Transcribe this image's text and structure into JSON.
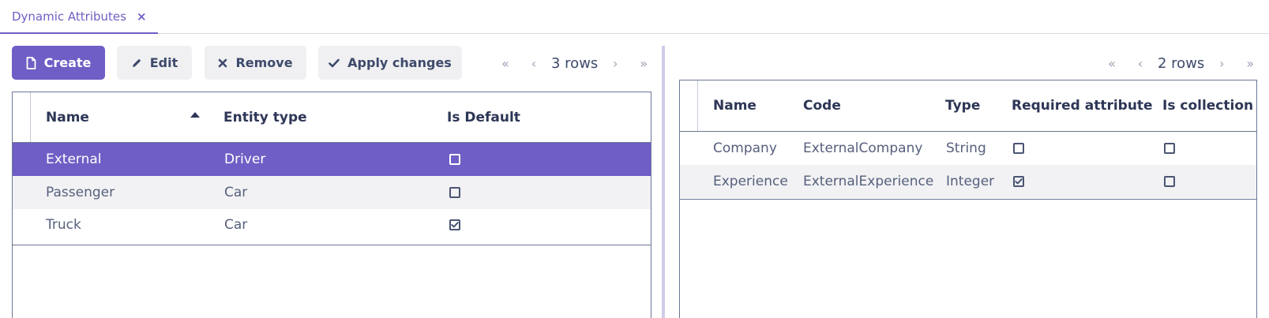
{
  "tab": {
    "label": "Dynamic Attributes",
    "close": "×"
  },
  "toolbar": {
    "create": "Create",
    "edit": "Edit",
    "remove": "Remove",
    "apply": "Apply changes"
  },
  "left_pager": {
    "first": "«",
    "prev": "‹",
    "rows": "3 rows",
    "next": "›",
    "last": "»"
  },
  "right_pager": {
    "first": "«",
    "prev": "‹",
    "rows": "2 rows",
    "next": "›",
    "last": "»"
  },
  "categories": {
    "headers": {
      "name": "Name",
      "entity_type": "Entity type",
      "is_default": "Is Default"
    },
    "sort": {
      "column": "name",
      "direction": "ascending"
    },
    "rows": [
      {
        "name": "External",
        "entity_type": "Driver",
        "is_default": false,
        "selected": true
      },
      {
        "name": "Passenger",
        "entity_type": "Car",
        "is_default": false,
        "selected": false
      },
      {
        "name": "Truck",
        "entity_type": "Car",
        "is_default": true,
        "selected": false
      }
    ]
  },
  "attributes": {
    "headers": {
      "name": "Name",
      "code": "Code",
      "type": "Type",
      "required": "Required attribute",
      "collection": "Is collection"
    },
    "rows": [
      {
        "name": "Company",
        "code": "ExternalCompany",
        "type": "String",
        "required": false,
        "collection": false
      },
      {
        "name": "Experience",
        "code": "ExternalExperience",
        "type": "Integer",
        "required": true,
        "collection": false
      }
    ]
  },
  "colors": {
    "accent": "#6f5ec5",
    "text": "#3d4a6b",
    "muted": "#9aa0b3",
    "stripe": "#f2f2f4"
  },
  "icons": {
    "create": "file-icon",
    "edit": "pencil-icon",
    "remove": "x-icon",
    "apply": "check-icon"
  }
}
